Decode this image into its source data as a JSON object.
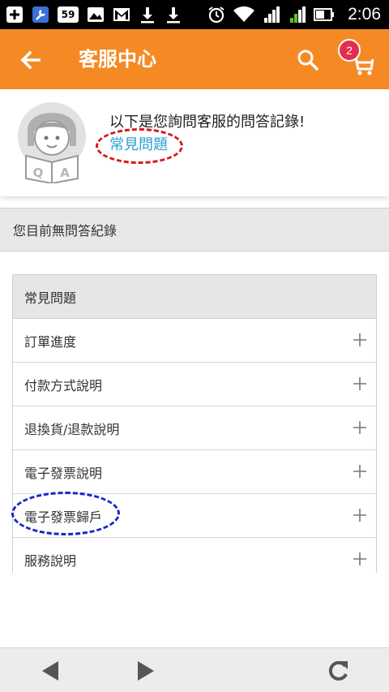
{
  "status_bar": {
    "time": "2:06",
    "battery_text": "59",
    "icons": [
      "plus-box-icon",
      "wrench-icon",
      "battery-59-icon",
      "image-icon",
      "gmail-icon",
      "download-icon",
      "download-icon",
      "alarm-icon",
      "wifi-icon",
      "signal-1-icon",
      "signal-2-icon",
      "battery-icon"
    ]
  },
  "app_bar": {
    "title": "客服中心",
    "cart_count": "2",
    "back_icon": "arrow-left-icon",
    "search_icon": "search-icon",
    "cart_icon": "cart-icon"
  },
  "intro": {
    "message": "以下是您詢問客服的問答記錄!",
    "faq_link": "常見問題"
  },
  "no_record": "您目前無問答紀錄",
  "faq": {
    "header": "常見問題",
    "items": [
      {
        "label": "訂單進度"
      },
      {
        "label": "付款方式說明"
      },
      {
        "label": "退換貨/退款說明"
      },
      {
        "label": "電子發票說明"
      },
      {
        "label": "電子發票歸戶"
      },
      {
        "label": "服務說明"
      }
    ]
  },
  "bottom_nav": {
    "back_icon": "triangle-left-icon",
    "forward_icon": "triangle-right-icon",
    "refresh_icon": "refresh-icon"
  },
  "colors": {
    "app_bar": "#f58a25",
    "link": "#2a9fd6",
    "badge": "#e52d4f",
    "annotation_red": "#d71a1a",
    "annotation_blue": "#1828c8"
  }
}
